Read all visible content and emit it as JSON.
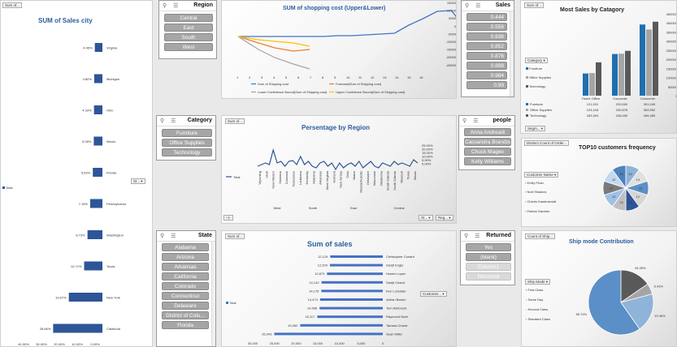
{
  "city_chart": {
    "title": "SUM of Sales city",
    "field_button": "Sum of...",
    "legend": "Total",
    "filter_button": "St...",
    "bars": [
      {
        "city": "Virginia",
        "label": "4.45%",
        "pct": 4.45
      },
      {
        "city": "Michigan",
        "label": "4.80%",
        "pct": 4.8
      },
      {
        "city": "Ohio",
        "label": "4.93%",
        "pct": 4.93
      },
      {
        "city": "Illinois",
        "label": "5.06%",
        "pct": 5.06
      },
      {
        "city": "Florida",
        "label": "5.63%",
        "pct": 5.63
      },
      {
        "city": "Pennsylvania",
        "label": "7.15%",
        "pct": 7.15
      },
      {
        "city": "Washington",
        "label": "8.73%",
        "pct": 8.73
      },
      {
        "city": "Texas",
        "label": "10.71%",
        "pct": 10.71
      },
      {
        "city": "New York",
        "label": "19.67%",
        "pct": 19.67
      },
      {
        "city": "California",
        "label": "28.86%",
        "pct": 28.86
      }
    ],
    "axis_ticks": [
      "40.00%",
      "30.00%",
      "20.00%",
      "10.00%",
      "0.00%"
    ]
  },
  "region_slicer": {
    "title": "Region",
    "items": [
      "Central",
      "East",
      "South",
      "West"
    ]
  },
  "category_slicer": {
    "title": "Category",
    "items": [
      "Furniture",
      "Office Supplies",
      "Technology"
    ]
  },
  "state_slicer": {
    "title": "State",
    "items": [
      "Alabama",
      "Arizona",
      "Arkansas",
      "California",
      "Colorado",
      "Connecticut",
      "Delaware",
      "District of Colu...",
      "Florida"
    ]
  },
  "sales_slicer": {
    "title": "Sales",
    "items": [
      "0.444",
      "0.556",
      "0.836",
      "0.852",
      "0.876",
      "0.898",
      "0.984",
      "0.99"
    ]
  },
  "people_slicer": {
    "title": "people",
    "items": [
      "Anna Andreadi",
      "Cassandra Brandow",
      "Chuck Magee",
      "Kelly Williams"
    ]
  },
  "returned_slicer": {
    "title": "Returned",
    "items": [
      "Yes",
      "(blank)",
      "Column1",
      "Returned"
    ]
  },
  "shipping_chart": {
    "title": "SUM of shopping cost (Upper&Lower)",
    "y_ticks": [
      "15000",
      "10000",
      "5000",
      "0",
      "-5000",
      "-10000",
      "-15000",
      "-20000",
      "-25000"
    ],
    "legend": [
      "Sum of Shipping cost",
      "Forecast(Sum of Shipping cost)",
      "Lower Confidence Bound(Sum of Shipping cost)",
      "Upper Confidence Bound(Sum of Shipping cost)"
    ],
    "colors": {
      "actual": "#4472c4",
      "forecast": "#ed7d31",
      "lower": "#a5a5a5",
      "upper": "#ffc000"
    }
  },
  "region_pct_chart": {
    "title": "Persentage by Region",
    "field_button": "Sum of...",
    "legend": "Total",
    "y_ticks": [
      "25.00%",
      "20.00%",
      "15.00%",
      "10.00%",
      "5.00%",
      "0.00%"
    ],
    "states": [
      "Wyoming",
      "Utah",
      "New Mexico",
      "Montana",
      "Colorado",
      "Tennessee",
      "Louisiana",
      "Kentucky",
      "Alabama",
      "Arkansas",
      "West Virginia",
      "Vermont",
      "New Jersey",
      "Ohio",
      "Maine",
      "Massachusetts",
      "Delaware",
      "Wisconsin",
      "Oklahoma",
      "South Dakota",
      "North Dakota",
      "Missouri",
      "Texas",
      "Illinois"
    ],
    "regions": [
      "West",
      "South",
      "East",
      "Central"
    ],
    "buttons": [
      "St...",
      "Reg..."
    ]
  },
  "category_chart": {
    "title": "Most Sales by Catagory",
    "field_button": "Sum of...",
    "legend_title": "Category",
    "legend": [
      "Furniture",
      "Office Supplies",
      "Technology"
    ],
    "y_ticks": [
      "450000",
      "400000",
      "350000",
      "300000",
      "250000",
      "200000",
      "150000",
      "100000",
      "50000",
      "0"
    ],
    "segments": [
      "Home Office",
      "Corporate",
      "Consumer"
    ],
    "table_rows": [
      {
        "name": "Furniture",
        "values": [
          "121,931",
          "229,000",
          "391,049"
        ]
      },
      {
        "name": "Office Supplies",
        "values": [
          "124,418",
          "230,676",
          "363,952"
        ]
      },
      {
        "name": "Technology",
        "values": [
          "183,304",
          "246,450",
          "406,480"
        ]
      }
    ],
    "seg_button": "Segm..."
  },
  "top10_chart": {
    "title": "TOP10 customers frequency",
    "field_button": "Distinct Count of Order...",
    "filter_title": "Customer Name",
    "names": [
      "Emily Phan",
      "Noel Staavos",
      "Chloris Kastensmidt",
      "Patrick Gardner"
    ],
    "slice_labels": [
      "12",
      "13",
      "12",
      "12",
      "13",
      "13",
      "12",
      "13",
      "12",
      "13"
    ]
  },
  "sales_chart": {
    "title": "Sum of sales",
    "field_button": "Sum of...",
    "legend": "Total",
    "filter_button": "Customer...",
    "bars": [
      {
        "name": "Christopher Conant",
        "label": "12,129",
        "value": 12129
      },
      {
        "name": "Sanjit Engle",
        "label": "12,209",
        "value": 12209
      },
      {
        "name": "Hunter Lopez",
        "label": "12,873",
        "value": 12873
      },
      {
        "name": "Sanjit Chand",
        "label": "14,142",
        "value": 14142
      },
      {
        "name": "Ken Lonsdale",
        "label": "14,175",
        "value": 14175
      },
      {
        "name": "Adrian Barton",
        "label": "14,474",
        "value": 14474
      },
      {
        "name": "Tom Ashbrook",
        "label": "14,596",
        "value": 14596
      },
      {
        "name": "Raymond Buch",
        "label": "15,117",
        "value": 15117
      },
      {
        "name": "Tamara Chand",
        "label": "19,052",
        "value": 19052
      },
      {
        "name": "Sean Miller",
        "label": "25,043",
        "value": 25043
      }
    ],
    "axis_ticks": [
      "30,000",
      "25,000",
      "20,000",
      "15,000",
      "10,000",
      "5,000",
      "0"
    ]
  },
  "ship_chart": {
    "title": "Ship mode Contribution",
    "field_button": "Count of Ship...",
    "filter_title": "Ship Mode",
    "modes": [
      "First Class",
      "Same Day",
      "Second Class",
      "Standard Class"
    ],
    "slices": [
      {
        "mode": "First Class",
        "label": "15.39%",
        "pct": 15.39
      },
      {
        "mode": "Same Day",
        "label": "5.43%",
        "pct": 5.43
      },
      {
        "mode": "Second Class",
        "label": "19.46%",
        "pct": 19.46
      },
      {
        "mode": "Standard Class",
        "label": "59.72%",
        "pct": 59.72
      }
    ]
  }
}
